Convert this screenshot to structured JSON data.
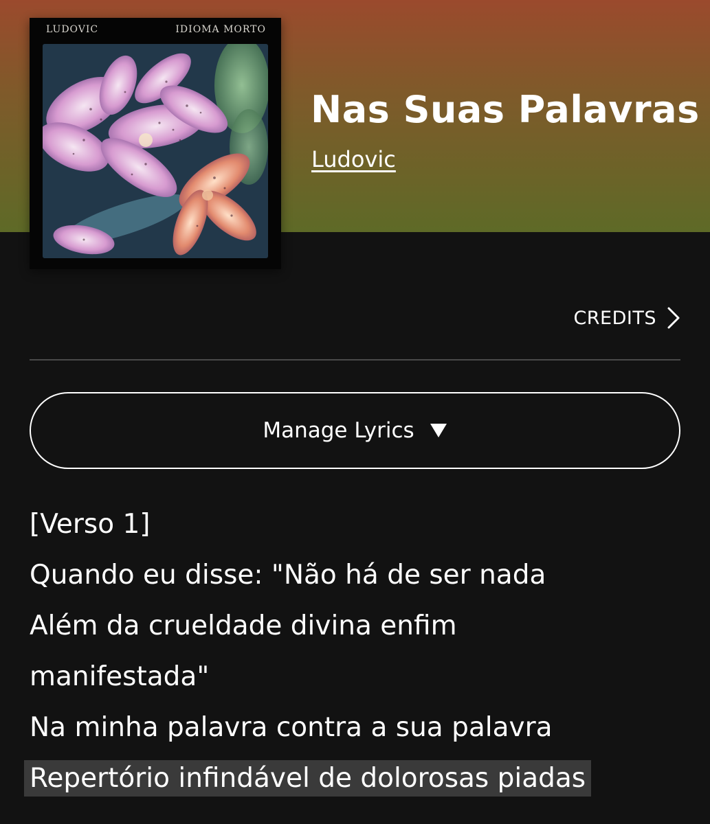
{
  "cover": {
    "artist_label": "LUDOVIC",
    "album_label": "IDIOMA MORTO"
  },
  "song": {
    "title": "Nas Suas Palavras",
    "artist": "Ludovic"
  },
  "credits": {
    "label": "CREDITS",
    "icon": "chevron-right-icon"
  },
  "manage_lyrics": {
    "label": "Manage Lyrics",
    "icon": "caret-down-icon"
  },
  "lyrics": {
    "lines": [
      "[Verso 1]",
      "Quando eu disse: \"Não há de ser nada",
      "Além da crueldade divina enfim",
      "manifestada\"",
      "Na minha palavra contra a sua palavra",
      "Repertório infindável de dolorosas piadas"
    ],
    "highlighted_line": "Repertório infindável de dolorosas piadas"
  },
  "colors": {
    "header_top": "#9b4a2d",
    "header_bottom": "#5e6a27",
    "background": "#121212",
    "highlight": "#3a3a3a"
  }
}
